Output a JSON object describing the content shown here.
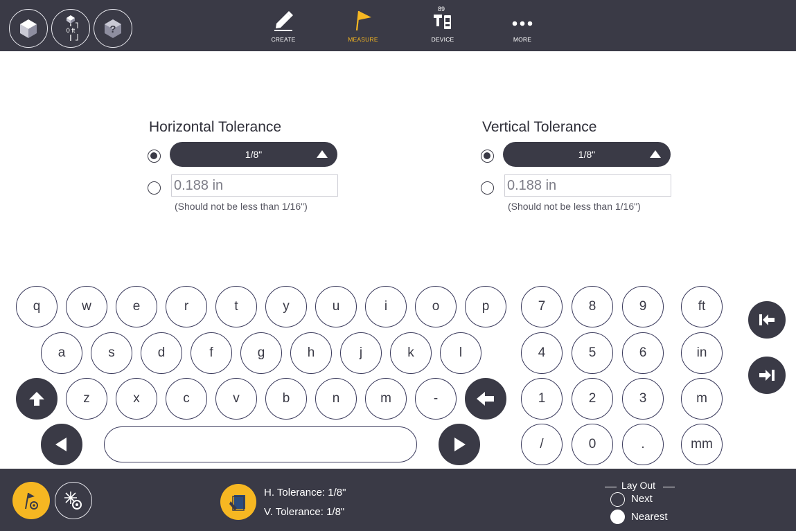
{
  "toolbar": {
    "left_buttons": [
      {
        "name": "view-cube-icon"
      },
      {
        "name": "rod-height-icon",
        "label": "0 ft"
      },
      {
        "name": "help-icon"
      }
    ],
    "nav": [
      {
        "name": "create",
        "label": "CREATE",
        "icon": "pencil-icon",
        "active": false
      },
      {
        "name": "measure",
        "label": "MEASURE",
        "icon": "flag-icon",
        "active": true
      },
      {
        "name": "device",
        "label": "DEVICE",
        "icon": "total-station-icon",
        "badge": "89",
        "active": false
      },
      {
        "name": "more",
        "label": "MORE",
        "icon": "ellipsis-icon",
        "active": false
      }
    ],
    "accent_color": "#f6b722",
    "bar_color": "#3a3a46"
  },
  "horizontal": {
    "title": "Horizontal Tolerance",
    "preset_value": "1/8\"",
    "preset_selected": true,
    "custom_value": "0.188 in",
    "hint": "(Should not be less than 1/16\")"
  },
  "vertical": {
    "title": "Vertical Tolerance",
    "preset_value": "1/8\"",
    "preset_selected": true,
    "custom_value": "0.188 in",
    "hint": "(Should not be less than 1/16\")"
  },
  "keyboard": {
    "row1": [
      "q",
      "w",
      "e",
      "r",
      "t",
      "y",
      "u",
      "i",
      "o",
      "p"
    ],
    "row2": [
      "a",
      "s",
      "d",
      "f",
      "g",
      "h",
      "j",
      "k",
      "l"
    ],
    "row3": [
      "z",
      "x",
      "c",
      "v",
      "b",
      "n",
      "m",
      "-"
    ],
    "numpad": [
      [
        "7",
        "8",
        "9"
      ],
      [
        "4",
        "5",
        "6"
      ],
      [
        "1",
        "2",
        "3"
      ],
      [
        "/",
        "0",
        "."
      ]
    ],
    "units": [
      "ft",
      "in",
      "m",
      "mm"
    ],
    "special_keys": [
      "shift-icon",
      "backspace-icon",
      "cursor-left-icon",
      "cursor-right-icon",
      "jump-to-start-icon",
      "jump-to-end-icon"
    ]
  },
  "status": {
    "h_tolerance": "H. Tolerance:  1/8\"",
    "v_tolerance": "V. Tolerance:  1/8\"",
    "layout_title": "Lay Out",
    "layout_options": [
      {
        "label": "Next",
        "selected": false
      },
      {
        "label": "Nearest",
        "selected": true
      }
    ]
  }
}
